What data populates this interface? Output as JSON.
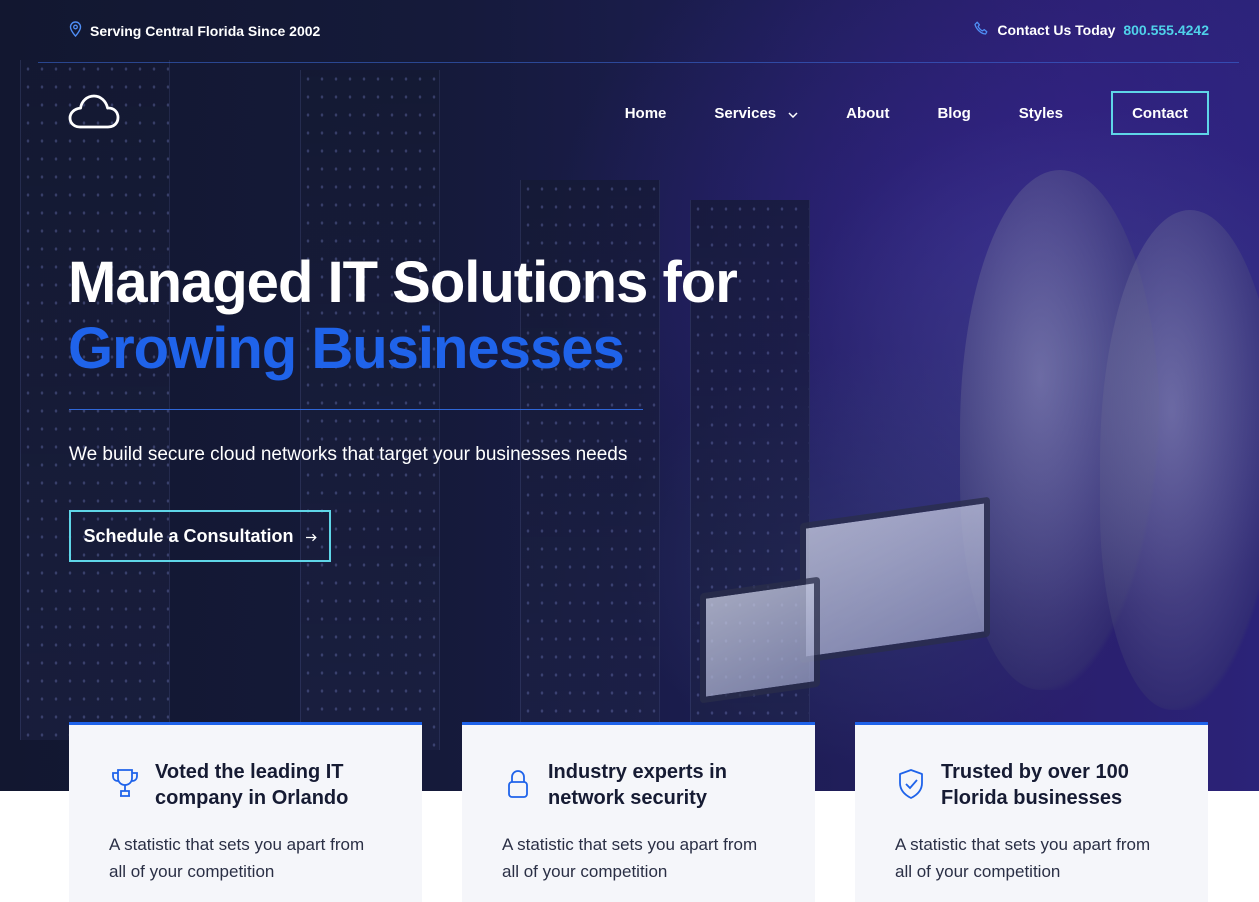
{
  "topbar": {
    "location_text": "Serving Central Florida Since 2002",
    "contact_label": "Contact Us Today",
    "phone": "800.555.4242"
  },
  "nav": {
    "items": [
      {
        "label": "Home"
      },
      {
        "label": "Services"
      },
      {
        "label": "About"
      },
      {
        "label": "Blog"
      },
      {
        "label": "Styles"
      }
    ],
    "contact_button": "Contact"
  },
  "hero": {
    "headline_line1": "Managed IT Solutions for",
    "headline_line2": "Growing Businesses",
    "subtext": "We build secure cloud networks that target your businesses needs",
    "cta_label": "Schedule a Consultation"
  },
  "cards": [
    {
      "icon": "trophy-icon",
      "title": "Voted the leading IT company in Orlando",
      "text": "A statistic that sets you apart from all of your competition"
    },
    {
      "icon": "lock-icon",
      "title": "Industry experts in network security",
      "text": "A statistic that sets you apart from all of your competition"
    },
    {
      "icon": "shield-check-icon",
      "title": "Trusted by over 100 Florida businesses",
      "text": "A statistic that sets you apart from all of your competition"
    }
  ],
  "colors": {
    "accent_blue": "#1f63ea",
    "accent_cyan": "#5fd6e8",
    "hero_dark": "#151a3a",
    "card_bg": "#f5f6fa"
  }
}
